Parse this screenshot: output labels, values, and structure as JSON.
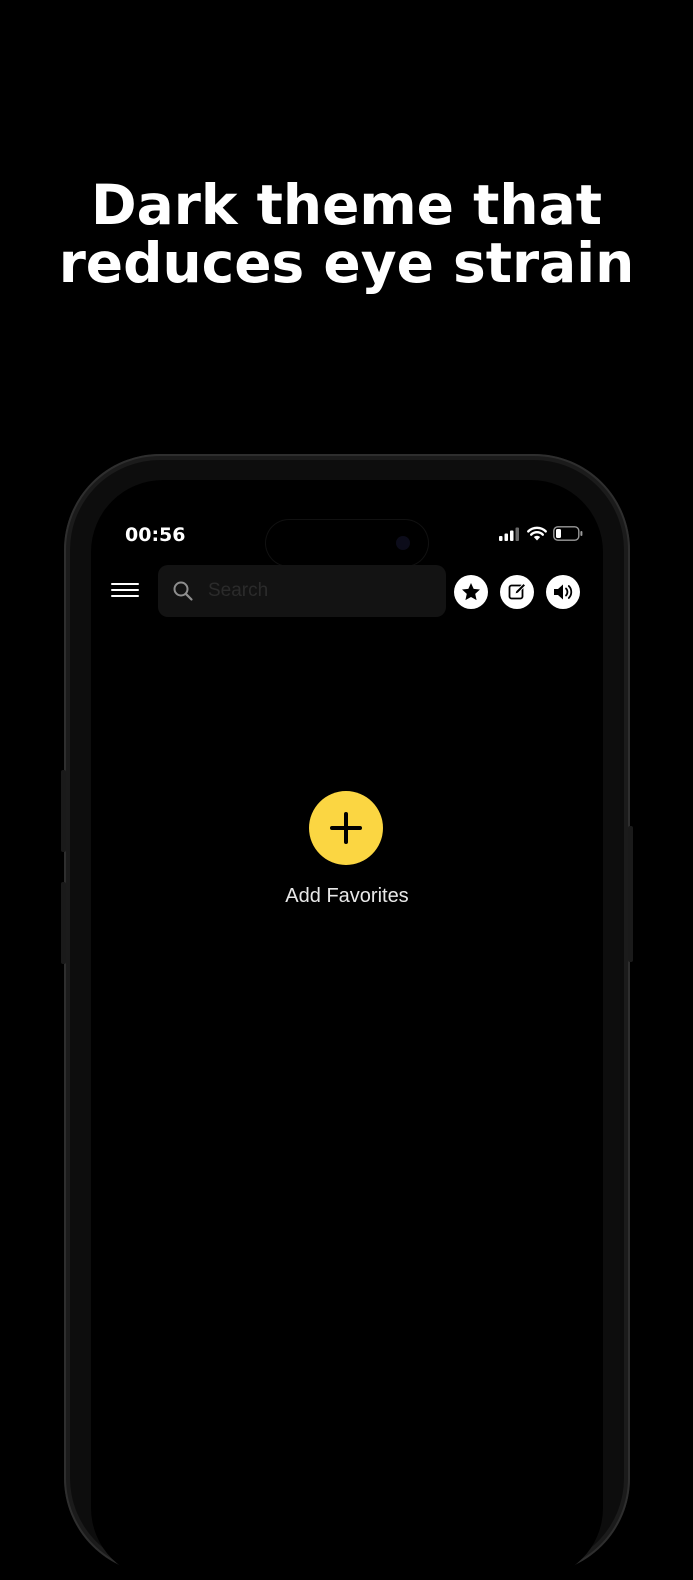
{
  "headline": {
    "line1": "Dark theme that",
    "line2": "reduces eye strain"
  },
  "status_bar": {
    "time": "00:56",
    "icons": [
      "cellular-signal-icon",
      "wifi-icon",
      "battery-icon"
    ]
  },
  "toolbar": {
    "menu_icon": "hamburger-menu-icon",
    "search": {
      "placeholder": "Search",
      "value": ""
    },
    "buttons": [
      "star-icon",
      "edit-icon",
      "speaker-icon"
    ]
  },
  "main": {
    "add_favorites_label": "Add Favorites",
    "add_icon": "plus-icon"
  },
  "colors": {
    "background": "#000000",
    "accent": "#fbd642",
    "text": "#ffffff"
  }
}
